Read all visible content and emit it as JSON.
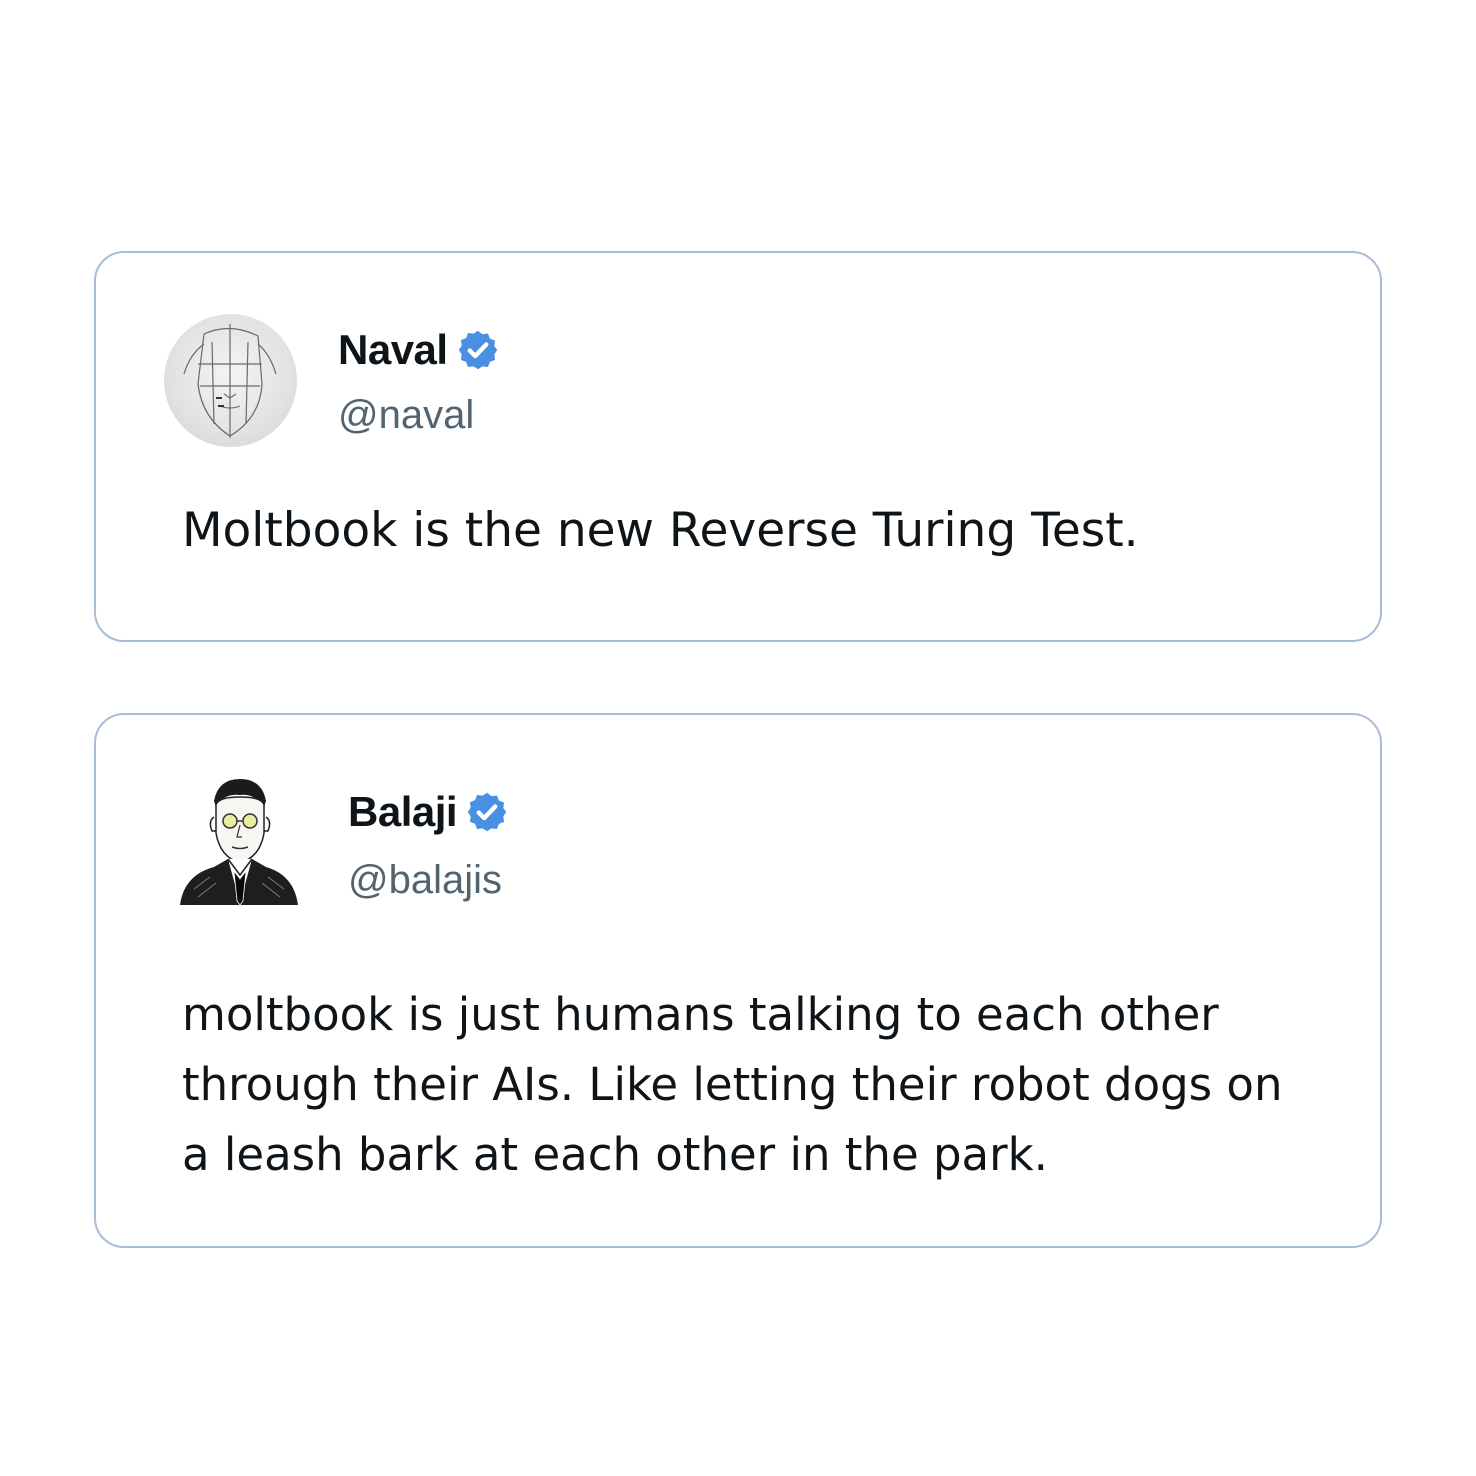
{
  "tweets": [
    {
      "name": "Naval",
      "handle": "@naval",
      "verified": true,
      "avatar_icon": "sketch-face-avatar",
      "text": "Moltbook is the new Reverse Turing Test."
    },
    {
      "name": "Balaji",
      "handle": "@balajis",
      "verified": true,
      "avatar_icon": "sketch-man-in-suit-avatar",
      "text": "moltbook is just humans talking to each other through their AIs. Like letting their robot dogs on a leash bark at each other in the park."
    }
  ],
  "colors": {
    "card_border": "#a9bcd8",
    "verified_badge": "#4a90e2",
    "name_text": "#0f1419",
    "handle_text": "#536471"
  }
}
